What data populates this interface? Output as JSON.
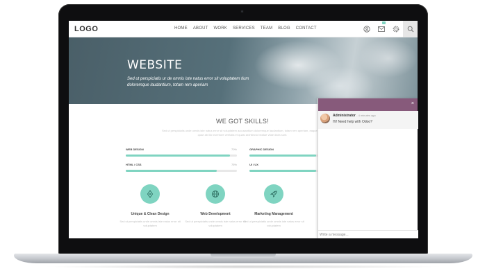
{
  "navbar": {
    "logo": "LOGO",
    "menu": [
      "HOME",
      "ABOUT",
      "WORK",
      "SERVICES",
      "TEAM",
      "BLOG",
      "CONTACT"
    ],
    "icons": [
      "user-icon",
      "mail-icon",
      "gear-icon",
      "search-icon"
    ]
  },
  "hero": {
    "title": "WEBSITE",
    "subtitle": "Sed ut perspiciatis ur de omnis iste natus error sit voluptatem tium doloremque laudantium, totam rem aperiam"
  },
  "skills": {
    "title": "WE GOT SKILLS!",
    "description": "Sed ut perspiciatis unde omnis iste natus error sit voluptatem accusantium doloremque laudantium, totam rem aperiam, eaque ipsa quae ab illo inventore veritatis et quasi architecto beatae vitae dicta sunt.",
    "items": [
      {
        "label": "WEB DESIGN",
        "pct": "70%",
        "value": 0.94
      },
      {
        "label": "GRAPHIC DESIGN",
        "pct": "",
        "value": 0.6
      },
      {
        "label": "HTML / CSS",
        "pct": "75%",
        "value": 0.82
      },
      {
        "label": "UI / UX",
        "pct": "",
        "value": 0.6
      }
    ]
  },
  "features": [
    {
      "icon": "pen-nib-icon",
      "title": "Unique & Clean Design",
      "text": "Sed ut perspiciatis unde omnis iste natus error sit voluptatem"
    },
    {
      "icon": "globe-icon",
      "title": "Web Development",
      "text": "Sed ut perspiciatis unde omnis iste natus error sit voluptatem"
    },
    {
      "icon": "rocket-icon",
      "title": "Marketing Management",
      "text": "Sed ut perspiciatis unde omnis iste natus error sit voluptatem"
    }
  ],
  "chat": {
    "close": "×",
    "author": "Administrator",
    "time": "- 4 minutes ago",
    "message": "Hi! Need help with Odoo?",
    "input_placeholder": "Write a message..."
  },
  "colors": {
    "accent": "#7fd4c1",
    "chat_header": "#875a7b"
  }
}
